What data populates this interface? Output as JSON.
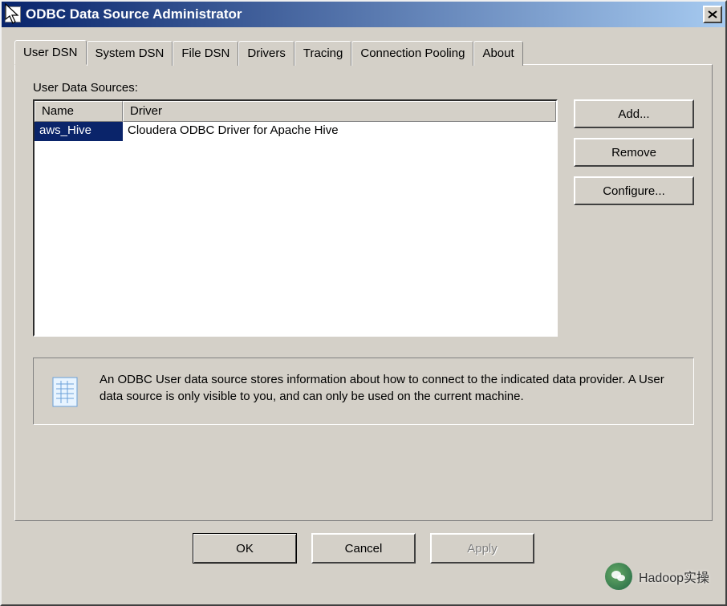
{
  "window": {
    "title": "ODBC Data Source Administrator"
  },
  "tabs": [
    {
      "label": "User DSN",
      "active": true
    },
    {
      "label": "System DSN",
      "active": false
    },
    {
      "label": "File DSN",
      "active": false
    },
    {
      "label": "Drivers",
      "active": false
    },
    {
      "label": "Tracing",
      "active": false
    },
    {
      "label": "Connection Pooling",
      "active": false
    },
    {
      "label": "About",
      "active": false
    }
  ],
  "panel": {
    "section_label": "User Data Sources:",
    "columns": {
      "name": "Name",
      "driver": "Driver"
    },
    "rows": [
      {
        "name": "aws_Hive",
        "driver": "Cloudera ODBC Driver for Apache Hive"
      }
    ],
    "buttons": {
      "add": "Add...",
      "remove": "Remove",
      "configure": "Configure..."
    },
    "info_text": "An ODBC User data source stores information about how to connect to the indicated data provider.   A User data source is only visible to you, and can only be used on the current machine."
  },
  "dialog_buttons": {
    "ok": "OK",
    "cancel": "Cancel",
    "apply": "Apply"
  },
  "watermark": "Hadoop实操"
}
